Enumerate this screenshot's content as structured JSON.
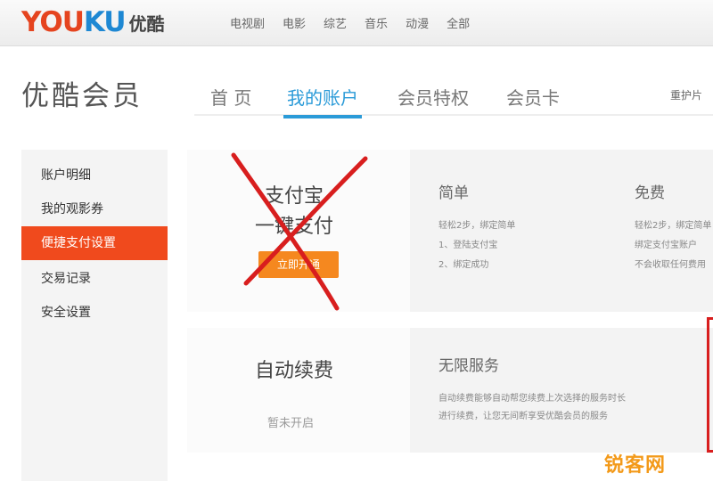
{
  "logo": {
    "latin_a": "YOU",
    "latin_b": "KU",
    "cn": "优酷"
  },
  "topnav": [
    "电视剧",
    "电影",
    "综艺",
    "音乐",
    "动漫",
    "全部"
  ],
  "member": {
    "title": "优酷会员",
    "tabs": [
      "首 页",
      "我的账户",
      "会员特权",
      "会员卡"
    ],
    "active_tab": "我的账户",
    "right_text": "重护片"
  },
  "sidebar": {
    "items": [
      "账户明细",
      "我的观影券",
      "便捷支付设置",
      "交易记录",
      "安全设置"
    ],
    "active": "便捷支付设置"
  },
  "card1": {
    "heading_line1": "支付宝",
    "heading_line2": "一键支付",
    "button": "立即开通",
    "col1": {
      "title": "简单",
      "lines": [
        "轻松2步，绑定简单",
        "1、登陆支付宝",
        "2、绑定成功"
      ]
    },
    "col2": {
      "title": "免费",
      "lines": [
        "轻松2步，绑定简单",
        "绑定支付宝账户",
        "不会收取任何费用"
      ]
    }
  },
  "card2": {
    "heading": "自动续费",
    "hint": "暂未开启",
    "col1": {
      "title": "无限服务",
      "lines": [
        "自动续费能够自动帮您续费上次选择的服务时长",
        "进行续费，让您无间断享受优酷会员的服务"
      ]
    }
  },
  "watermark": "锐客网",
  "colors": {
    "brand_orange": "#f04a1d",
    "link_blue": "#2b9bd8",
    "button_orange": "#f5881f",
    "cross_red": "#d81e1e"
  },
  "icons": {
    "cross_mark": "red-x-cross-mark"
  }
}
